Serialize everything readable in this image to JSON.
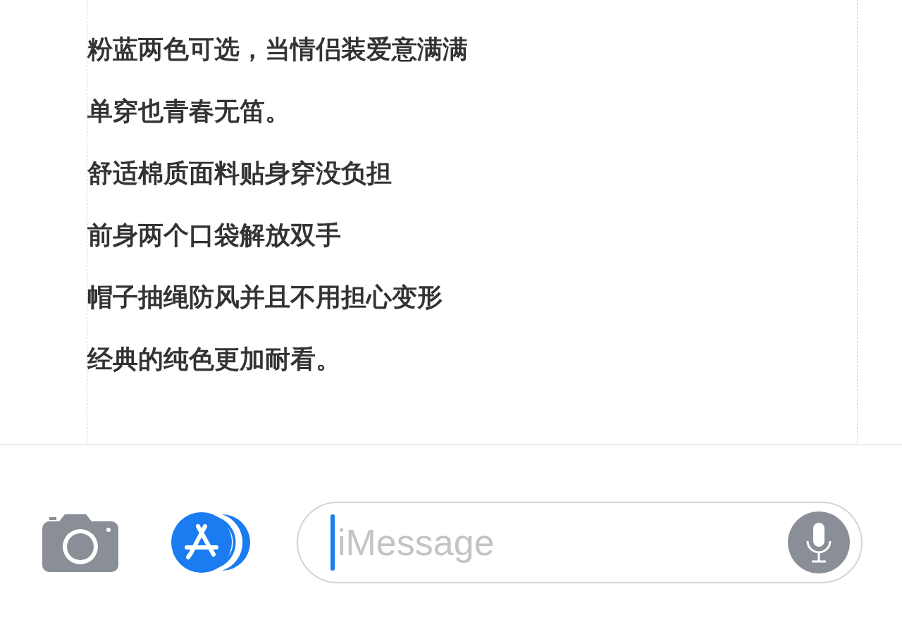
{
  "message": {
    "lines": [
      "粉蓝两色可选，当情侣装爱意满满",
      "单穿也青春无笛。",
      "舒适棉质面料贴身穿没负担",
      "前身两个口袋解放双手",
      "帽子抽绳防风并且不用担心变形",
      "经典的纯色更加耐看。"
    ]
  },
  "compose": {
    "placeholder": "iMessage",
    "focused": true
  }
}
